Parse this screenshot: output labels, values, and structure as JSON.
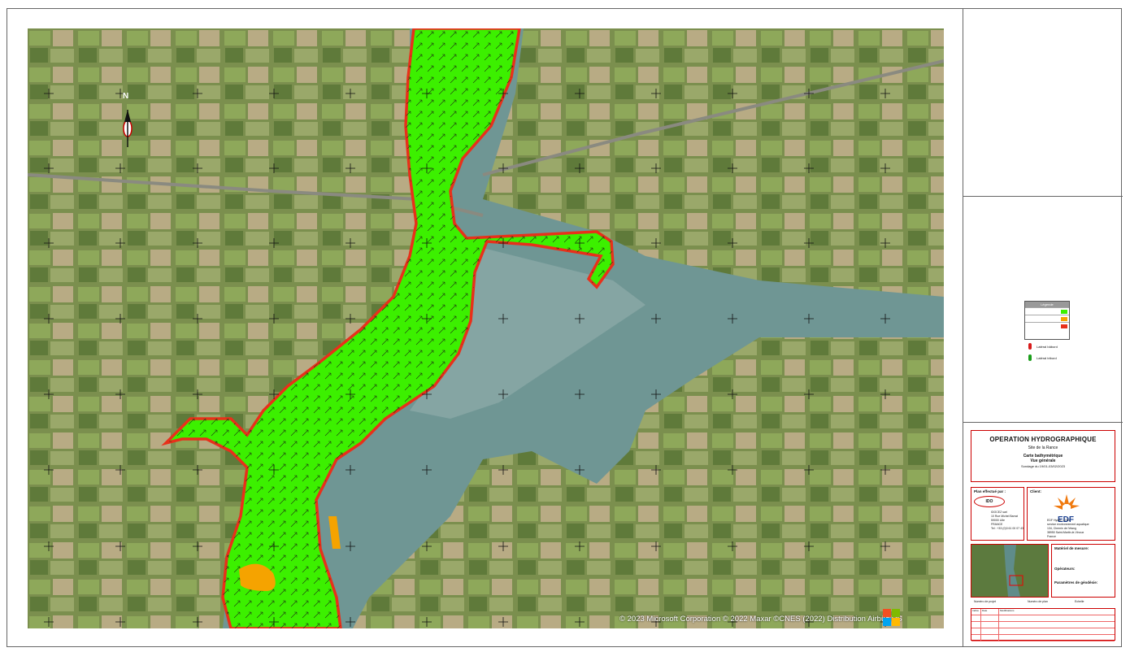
{
  "map": {
    "copyright": "© 2023 Microsoft Corporation © 2022 Maxar ©CNES (2022) Distribution Airbus DS",
    "north_label": "N",
    "colors": {
      "green": "#3cf000",
      "orange": "#f5a300",
      "red": "#e8301a",
      "water": "#5f8c8a"
    }
  },
  "legend": {
    "title": "Légende",
    "indicator_1": "Latéral bâbord",
    "indicator_2": "Latéral tribord"
  },
  "title_block": {
    "title": "OPERATION HYDROGRAPHIQUE",
    "site": "Site de la Rance",
    "map_type": "Carte bathymétrique",
    "view": "Vue générale",
    "survey_date": "Sondage du 19/01-03/02/2023"
  },
  "performed_by": {
    "heading": "Plan effectué par :",
    "logo_text": "IDO",
    "lines": [
      "IDOCEZ sarl",
      "10 Rue Michel Barrat",
      "59000 Lille",
      "FRANCE",
      "Tel : +33 (0)3 61 00 07 43"
    ]
  },
  "client": {
    "heading": "Client:",
    "logo_text": "EDF",
    "lines": [
      "EDF Hydro - DTG",
      "service environnement aquatique",
      "134, Chemin de l'étang",
      "38950 Saint-Martin-le-Vinoux",
      "France"
    ]
  },
  "info": {
    "measure_heading": "Matériel de mesure:",
    "operators_heading": "Opérateurs:",
    "geodesy_heading": "Paramètres de géodésie:"
  },
  "footer": {
    "project_label": "Numéro de projet",
    "plan_label": "Numéro de plan",
    "scale_label": "Echelle",
    "revision_headers": [
      "Indice",
      "Date",
      "Modifications"
    ]
  }
}
